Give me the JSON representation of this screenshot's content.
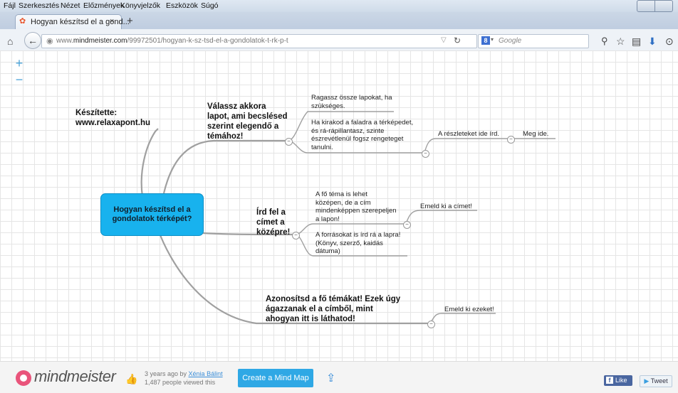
{
  "menu": {
    "file": "Fájl",
    "edit": "Szerkesztés",
    "view": "Nézet",
    "history": "Előzmények",
    "bookmarks": "Könyvjelzők",
    "tools": "Eszközök",
    "help": "Súgó"
  },
  "tab": {
    "title": "Hogyan készítsd el a gond...",
    "close": "×",
    "new_tab": "+"
  },
  "nav": {
    "url_prefix": "www.",
    "url_domain": "mindmeister.com",
    "url_path": "/99972501/hogyan-k-sz-tsd-el-a-gondolatok-t-rk-p-t",
    "search_placeholder": "Google",
    "search_engine": "8"
  },
  "zoom": {
    "in": "+",
    "out": "−"
  },
  "mindmap": {
    "root": "Hogyan készítsd el a gondolatok térképét?",
    "author_line1": "Készítette:",
    "author_line2": "www.relaxapont.hu",
    "branch1": {
      "label_lines": [
        "Válassz akkora",
        "lapot, ami becslésed",
        "szerint elegendő a",
        "témához!"
      ],
      "child1_lines": [
        "Ragassz össze lapokat, ha",
        "szükséges."
      ],
      "child2_lines": [
        "Ha kirakod a faladra a térképedet,",
        "és rá-rápillantasz, szinte",
        "észrevétlenül fogsz rengeteget",
        "tanulni."
      ],
      "detail": "A részleteket ide írd.",
      "detail2": "Meg ide."
    },
    "branch2": {
      "label_lines": [
        "Írd fel a",
        "címet a",
        "középre!"
      ],
      "child1_lines": [
        "A fő téma is lehet",
        "középen, de a cím",
        "mindenképpen szerepeljen",
        "a lapon!"
      ],
      "child2_lines": [
        "A forrásokat is írd rá a lapra!",
        "(Könyv, szerző, kaidás",
        "dátuma)"
      ],
      "detail": "Emeld ki a címet!"
    },
    "branch3": {
      "label_lines": [
        "Azonosítsd a fő témákat! Ezek úgy",
        "ágazzanak el a címből, mint",
        "ahogyan itt is láthatod!"
      ],
      "detail": "Emeld ki ezeket!"
    }
  },
  "footer": {
    "logo": "mindmeister",
    "author_prefix": "3 years ago by ",
    "author_name": "Xénia Bálint",
    "views": "1,487 people viewed this",
    "create_button": "Create a Mind Map",
    "fb_like": "Like",
    "tweet": "Tweet"
  },
  "colors": {
    "root_fill": "#18b2ee",
    "accent": "#2fa8e5",
    "branch_line": "#999999"
  }
}
